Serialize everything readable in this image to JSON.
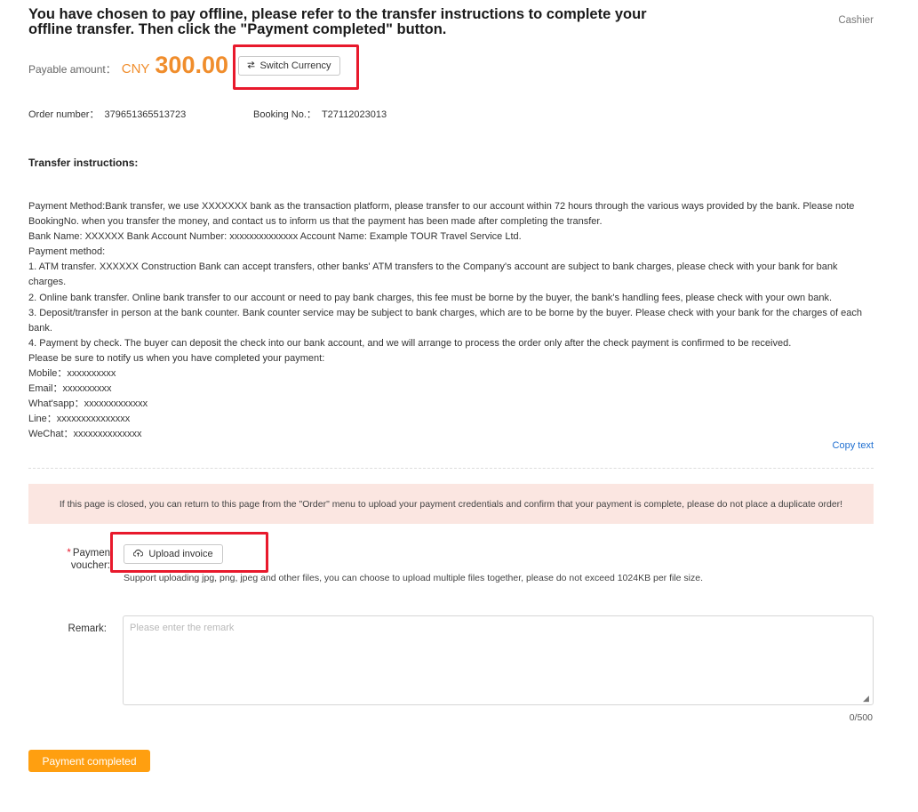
{
  "header": {
    "title": "You have chosen to pay offline, please refer to the transfer instructions to complete your offline transfer. Then click the \"Payment completed\" button.",
    "breadcrumb": "Cashier"
  },
  "payment": {
    "label": "Payable amount：",
    "currency": "CNY",
    "amount": "300.00",
    "switch_currency_label": "Switch Currency",
    "switch_icon": "swap-arrows-icon"
  },
  "order": {
    "order_number_label": "Order number：",
    "order_number": "379651365513723",
    "booking_label": "Booking No.：",
    "booking_number": "T27112023013"
  },
  "instructions": {
    "title": "Transfer instructions:",
    "lines": [
      "Payment Method:Bank transfer, we use XXXXXXX bank as the transaction platform, please transfer to our account within 72 hours through the various ways provided by the bank. Please note BookingNo. when you transfer the money, and contact us to inform us that the payment has been made after completing the transfer.",
      "Bank Name: XXXXXX Bank Account Number: xxxxxxxxxxxxxx Account Name: Example TOUR Travel Service Ltd.",
      "Payment method:",
      "1. ATM transfer. XXXXXX Construction Bank can accept transfers, other banks' ATM transfers to the Company's account are subject to bank charges, please check with your bank for bank charges.",
      "2. Online bank transfer. Online bank transfer to our account or need to pay bank charges, this fee must be borne by the buyer, the bank's handling fees, please check with your own bank.",
      "3. Deposit/transfer in person at the bank counter. Bank counter service may be subject to bank charges, which are to be borne by the buyer. Please check with your bank for the charges of each bank.",
      "4. Payment by check. The buyer can deposit the check into our bank account, and we will arrange to process the order only after the check payment is confirmed to be received.",
      "Please be sure to notify us when you have completed your payment:",
      "Mobile：xxxxxxxxxx",
      "Email：xxxxxxxxxx",
      "What'sapp：xxxxxxxxxxxxx",
      "Line：xxxxxxxxxxxxxxx",
      "WeChat：xxxxxxxxxxxxxx"
    ],
    "copy_label": "Copy text"
  },
  "notice": "If this page is closed, you can return to this page from the \"Order\" menu to upload your payment credentials and confirm that your payment is complete, please do not place a duplicate order!",
  "voucher": {
    "required_mark": "*",
    "label_line1": "Paymen",
    "label_line2": "voucher:",
    "upload_label": "Upload invoice",
    "upload_icon": "cloud-upload-icon",
    "hint": "Support uploading jpg, png, jpeg and other files, you can choose to upload multiple files together, please do not exceed 1024KB per file size."
  },
  "remark": {
    "label": "Remark:",
    "placeholder": "Please enter the remark",
    "value": "",
    "counter": "0/500"
  },
  "submit_label": "Payment completed",
  "colors": {
    "accent_orange": "#f08d2c",
    "button_orange": "#ff9f10",
    "highlight_red": "#e8192c",
    "link_blue": "#1f6fd1",
    "notice_bg": "#fbe6e1"
  }
}
